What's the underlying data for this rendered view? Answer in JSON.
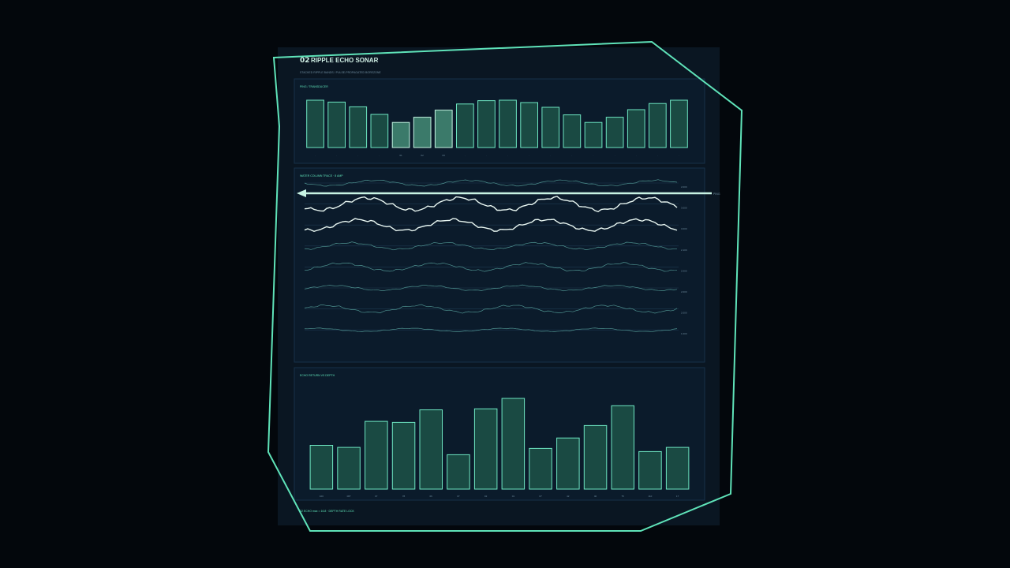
{
  "colors": {
    "background": "#03070c",
    "card": "#0a1622",
    "panel": "#0b1b2b",
    "panel_border": "#173048",
    "accent": "#5fe3b9",
    "bar_fill": "#1a4a43",
    "bar_stroke": "#6ee6c2",
    "bar_highlight_fill": "#3b7a6a",
    "bar_highlight_stroke": "#c4f5e2",
    "wave_bright": "#e8f6f1",
    "wave_dim": "#5aa8a2",
    "muted_text": "#6f8c9e"
  },
  "header": {
    "number": "02",
    "title": "RIPPLE ECHO SONAR",
    "subtitle": "STACKED RIPPLE BANDS / PULSE-PROPAGATED BOREZONE"
  },
  "footer": {
    "note": "02 ECHO max = 16.8 · DEPTH RATE LOCK"
  },
  "chart_data": [
    {
      "type": "bar",
      "title": "PING / TRANSDUCER",
      "values": [
        10,
        9.6,
        8.6,
        7.0,
        5.3,
        6.4,
        7.9,
        9.2,
        9.9,
        10.0,
        9.5,
        8.5,
        6.9,
        5.3,
        6.4,
        8.0,
        9.3,
        10.0
      ],
      "highlight": [
        4,
        5,
        6
      ],
      "tick_labels": [
        "·",
        "·",
        "·",
        "·",
        "01",
        "02",
        "03",
        "·",
        "·",
        "·",
        "·",
        "·",
        "·",
        "·",
        "·",
        "·",
        "·",
        "·"
      ],
      "ylim": [
        0,
        10
      ]
    },
    {
      "type": "line",
      "title": "WATER COLUMN TRACE · 8 AMP",
      "series": [
        {
          "emphasis": "dim",
          "amp": 1.0,
          "label": "2.000"
        },
        {
          "emphasis": "bright",
          "amp": 2.3,
          "label": "3.000"
        },
        {
          "emphasis": "bright",
          "amp": 2.0,
          "label": "3.000"
        },
        {
          "emphasis": "dim",
          "amp": 1.2,
          "label": "2.100"
        },
        {
          "emphasis": "dim",
          "amp": 1.4,
          "label": "2.000"
        },
        {
          "emphasis": "dim",
          "amp": 0.9,
          "label": "2.000"
        },
        {
          "emphasis": "dim",
          "amp": 1.3,
          "label": "2.000"
        },
        {
          "emphasis": "dim",
          "amp": 0.6,
          "label": "1.000"
        }
      ],
      "ping_marker": {
        "label": "PING"
      }
    },
    {
      "type": "bar",
      "title": "ECHO RETURN VS DEPTH",
      "categories": [
        "100",
        "087",
        "07",
        "78",
        "06",
        "07",
        "02",
        "01",
        "07",
        "42",
        "40",
        "75",
        "110",
        "17"
      ],
      "values": [
        4.2,
        4.0,
        6.5,
        6.4,
        7.6,
        3.3,
        7.7,
        8.7,
        3.9,
        4.9,
        6.1,
        8.0,
        3.6,
        4.0
      ],
      "ylim": [
        0,
        10
      ]
    }
  ]
}
